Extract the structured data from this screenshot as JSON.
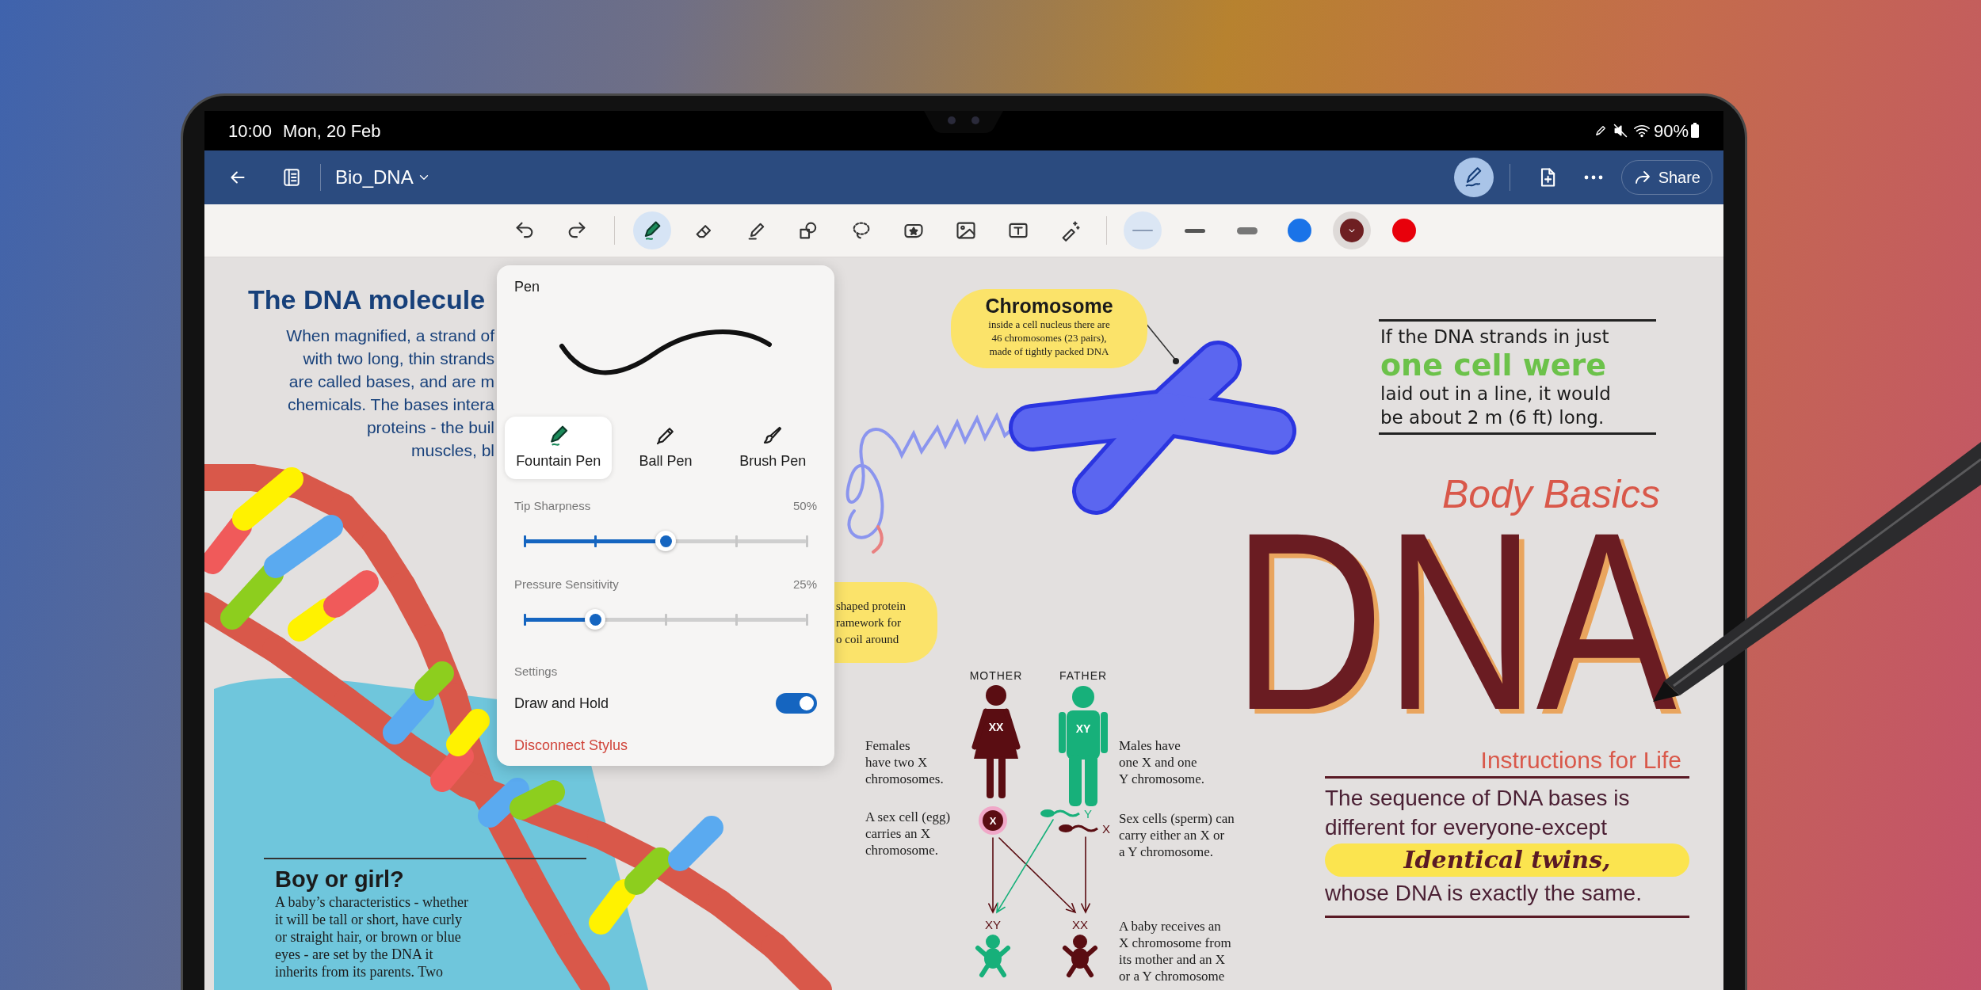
{
  "status_bar": {
    "time": "10:00",
    "date": "Mon, 20 Feb",
    "battery": "90%"
  },
  "app_bar": {
    "title": "Bio_DNA",
    "actions": [
      {
        "kind": "stylus",
        "selected": true
      },
      {
        "kind": "add-page",
        "selected": false
      },
      {
        "kind": "more",
        "selected": false
      }
    ],
    "share": "Share"
  },
  "toolbar": {
    "history": [
      {
        "kind": "undo"
      },
      {
        "kind": "redo"
      }
    ],
    "tools": [
      {
        "kind": "pen",
        "selected": true
      },
      {
        "kind": "eraser",
        "selected": false
      },
      {
        "kind": "highlighter",
        "selected": false
      },
      {
        "kind": "shapes",
        "selected": false
      },
      {
        "kind": "lasso",
        "selected": false
      },
      {
        "kind": "sticker",
        "selected": false
      },
      {
        "kind": "image",
        "selected": false
      },
      {
        "kind": "text",
        "selected": false
      },
      {
        "kind": "magic",
        "selected": false
      }
    ],
    "thicknesses": [
      {
        "kind": "thin",
        "selected": true
      },
      {
        "kind": "medium",
        "selected": false
      },
      {
        "kind": "thick",
        "selected": false
      }
    ],
    "colors": [
      {
        "color": "#1a73e8",
        "selected": false
      },
      {
        "color": "#6e1f22",
        "selected": true
      },
      {
        "color": "#e8000b",
        "selected": false
      }
    ]
  },
  "pen_panel": {
    "title": "Pen",
    "pen_types": [
      {
        "kind": "fountain",
        "label": "Fountain Pen",
        "selected": true
      },
      {
        "kind": "ball",
        "label": "Ball Pen",
        "selected": false
      },
      {
        "kind": "brush",
        "label": "Brush Pen",
        "selected": false
      }
    ],
    "sliders": [
      {
        "label": "Tip Sharpness",
        "reading": "50%",
        "level": 0.5
      },
      {
        "label": "Pressure Sensitivity",
        "reading": "25%",
        "level": 0.25
      }
    ],
    "settings_heading": "Settings",
    "toggles": [
      {
        "label": "Draw and Hold",
        "on": true
      }
    ],
    "disconnect": "Disconnect Stylus"
  },
  "note": {
    "molecule": {
      "title": "The DNA molecule",
      "lines": [
        "When magnified, a strand of",
        "with two long, thin strands",
        "are called bases, and are m",
        "chemicals. The bases intera",
        "proteins - the buil",
        "muscles, bl"
      ]
    },
    "boy_or_girl": {
      "title": "Boy or girl?",
      "lines": [
        "A baby’s characteristics - whether",
        "it will be tall or short, have curly",
        "or straight hair, or brown or blue",
        "eyes - are set by the DNA it",
        "inherits from its parents. Two"
      ]
    },
    "chromosome": {
      "title": "Chromosome",
      "lines": [
        "inside a cell nucleus there are",
        "46 chromosomes (23 pairs),",
        "made of tightly packed DNA"
      ]
    },
    "protein": {
      "lines": [
        "shaped protein",
        "ramework for",
        "o coil around"
      ]
    },
    "inheritance": {
      "parents": [
        {
          "kind": "female",
          "label": "MOTHER",
          "chromosomes": "XX",
          "color": "#5a0d12"
        },
        {
          "kind": "male",
          "label": "FATHER",
          "chromosomes": "XY",
          "color": "#17b07a"
        }
      ],
      "egg": "X",
      "sperm": [
        {
          "label": "Y",
          "color": "#17b07a"
        },
        {
          "label": "X",
          "color": "#5a0d12"
        }
      ],
      "babies": [
        {
          "label": "XY",
          "color": "#17b07a"
        },
        {
          "label": "XX",
          "color": "#5a0d12"
        }
      ],
      "notes": [
        {
          "lines": [
            "Females",
            "have two X",
            "chromosomes."
          ]
        },
        {
          "lines": [
            "A sex cell (egg)",
            "carries an X",
            "chromosome."
          ]
        },
        {
          "lines": [
            "Males have",
            "one X and one",
            "Y chromosome."
          ]
        },
        {
          "lines": [
            "Sex cells (sperm) can",
            "carry either an X or",
            "a Y chromosome."
          ]
        },
        {
          "lines": [
            "A baby receives an",
            "X chromosome from",
            "its mother and an X",
            "or a Y chromosome"
          ]
        }
      ]
    },
    "fact": {
      "lines": [
        {
          "text": "If the DNA strands in just",
          "kind": "plain"
        },
        {
          "text": "one cell were",
          "kind": "emphasis"
        },
        {
          "text": "laid out in a line, it would",
          "kind": "plain"
        },
        {
          "text": "be about 2 m (6 ft) long.",
          "kind": "plain"
        }
      ]
    },
    "heading": {
      "kicker": "Body Basics",
      "title": "DNA",
      "subtitle": "Instructions for Life"
    },
    "sequence": {
      "lines": [
        "The sequence of DNA bases is",
        "different for everyone-except"
      ],
      "highlight": "Identical twins,",
      "closing": "whose DNA is exactly the same."
    }
  }
}
